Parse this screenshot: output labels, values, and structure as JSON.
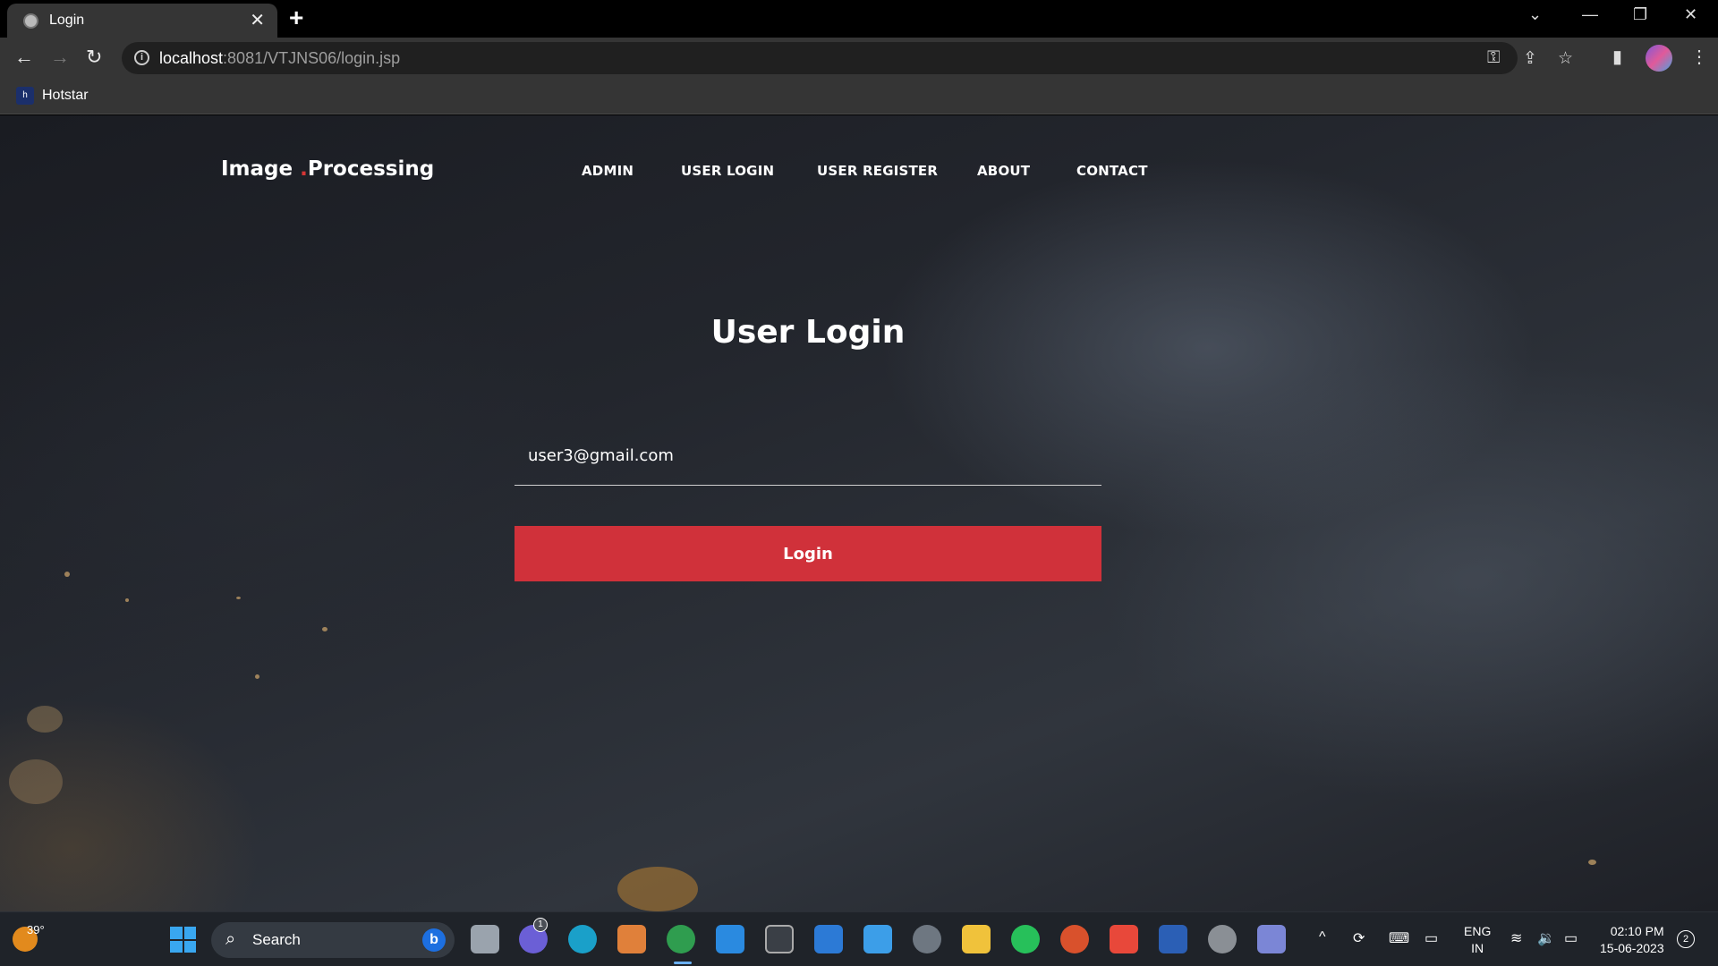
{
  "browser": {
    "tab_title": "Login",
    "url_host": "localhost",
    "url_path": ":8081/VTJNS06/login.jsp",
    "bookmark_label": "Hotstar",
    "bookmark_icon_text": "h"
  },
  "site": {
    "brand_part1": "Image",
    "brand_part2": "Processing",
    "nav": [
      "ADMIN",
      "USER LOGIN",
      "USER REGISTER",
      "ABOUT",
      "CONTACT"
    ]
  },
  "form": {
    "heading": "User Login",
    "email_value": "user3@gmail.com",
    "password_value": "••••••",
    "login_label": "Login"
  },
  "taskbar": {
    "temperature": "39°",
    "search_label": "Search",
    "teams_badge": "1",
    "lang_line1": "ENG",
    "lang_line2": "IN",
    "time": "02:10 PM",
    "date": "15-06-2023",
    "notification_count": "2"
  },
  "colors": {
    "accent": "#d0313a",
    "chrome_bg": "#353535",
    "taskbar_bg": "#1f2329"
  }
}
